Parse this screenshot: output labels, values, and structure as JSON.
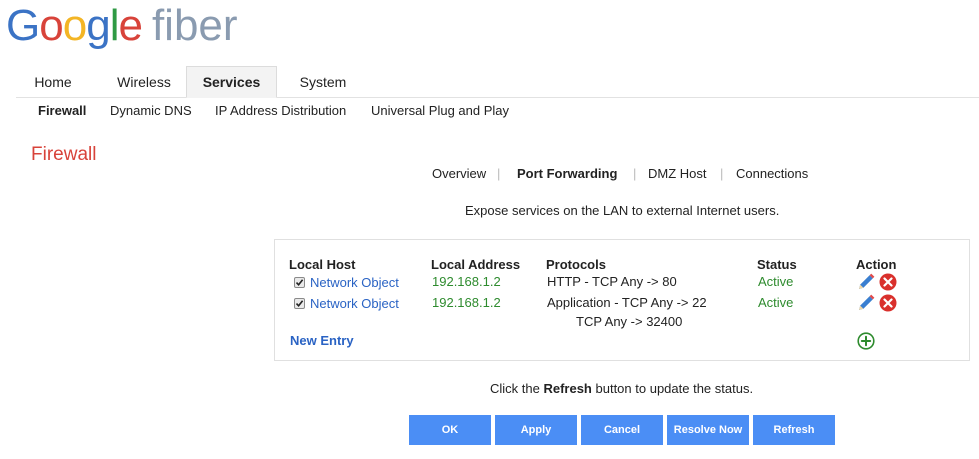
{
  "brand": {
    "logo_letters": [
      "G",
      "o",
      "o",
      "g",
      "l",
      "e"
    ],
    "logo_suffix": "fiber"
  },
  "main_tabs": [
    {
      "label": "Home"
    },
    {
      "label": "Wireless"
    },
    {
      "label": "Services",
      "active": true
    },
    {
      "label": "System"
    }
  ],
  "sub_tabs": [
    {
      "label": "Firewall",
      "active": true
    },
    {
      "label": "Dynamic DNS"
    },
    {
      "label": "IP Address Distribution"
    },
    {
      "label": "Universal Plug and Play"
    }
  ],
  "page_title": "Firewall",
  "firewall_nav": [
    {
      "label": "Overview"
    },
    {
      "label": "Port Forwarding",
      "active": true
    },
    {
      "label": "DMZ Host"
    },
    {
      "label": "Connections"
    }
  ],
  "firewall_nav_separator": "|",
  "description": "Expose services on the LAN to external Internet users.",
  "table": {
    "headers": {
      "local_host": "Local Host",
      "local_address": "Local Address",
      "protocols": "Protocols",
      "status": "Status",
      "action": "Action"
    },
    "rows": [
      {
        "checked": true,
        "local_host": "Network Object",
        "local_address": "192.168.1.2",
        "protocols": [
          "HTTP - TCP Any -> 80"
        ],
        "status": "Active"
      },
      {
        "checked": true,
        "local_host": "Network Object",
        "local_address": "192.168.1.2",
        "protocols": [
          "Application - TCP Any -> 22",
          "TCP Any -> 32400"
        ],
        "status": "Active"
      }
    ],
    "new_entry_label": "New Entry"
  },
  "hint": {
    "before": "Click the ",
    "bold": "Refresh",
    "after": " button to update the status."
  },
  "buttons": {
    "ok": "OK",
    "apply": "Apply",
    "cancel": "Cancel",
    "resolve_now": "Resolve Now",
    "refresh": "Refresh"
  },
  "icons": {
    "edit": "pencil-icon",
    "delete": "delete-x-icon",
    "add": "plus-circle-icon",
    "checkbox": "checkmark-icon"
  },
  "colors": {
    "accent_blue": "#4b8ef5",
    "link_blue": "#2a63c4",
    "title_red": "#d8433a",
    "status_green": "#2e8b2e",
    "delete_red": "#d9302c",
    "add_green": "#2e8b2e"
  }
}
